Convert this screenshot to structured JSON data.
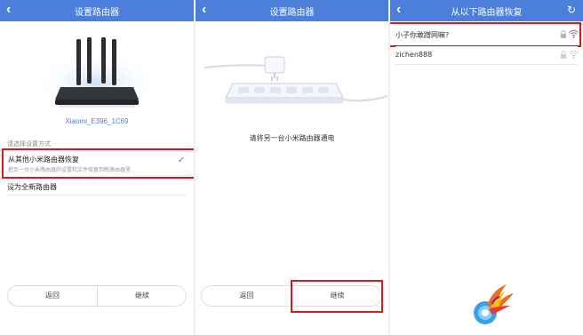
{
  "panel1": {
    "title": "设置路由器",
    "back_icon": "chevron-left-icon",
    "router_name": "Xiaomi_E396_1C69",
    "section_label": "请选择设置方式",
    "option_restore": {
      "title": "从其他小米路由器恢复",
      "subtitle": "把另一台小米路由器的设置和文件恢复到新路由器里",
      "selected": true
    },
    "option_new": "设为全新路由器",
    "buttons": {
      "back": "返回",
      "continue": "继续"
    }
  },
  "panel2": {
    "title": "设置路由器",
    "back_icon": "chevron-left-icon",
    "message": "请将另一台小米路由器通电",
    "buttons": {
      "back": "返回",
      "continue": "继续"
    }
  },
  "panel3": {
    "title": "从以下路由器恢复",
    "back_icon": "chevron-left-icon",
    "refresh_icon": "refresh-icon",
    "networks": [
      {
        "ssid": "小子你敢蹭网嘛?",
        "locked": true,
        "signal": "strong"
      },
      {
        "ssid": "zichen888",
        "locked": true,
        "signal": "weak"
      }
    ]
  },
  "colors": {
    "accent": "#4b7fdb",
    "highlight": "#d9191d",
    "divider": "#e8e8e8"
  }
}
